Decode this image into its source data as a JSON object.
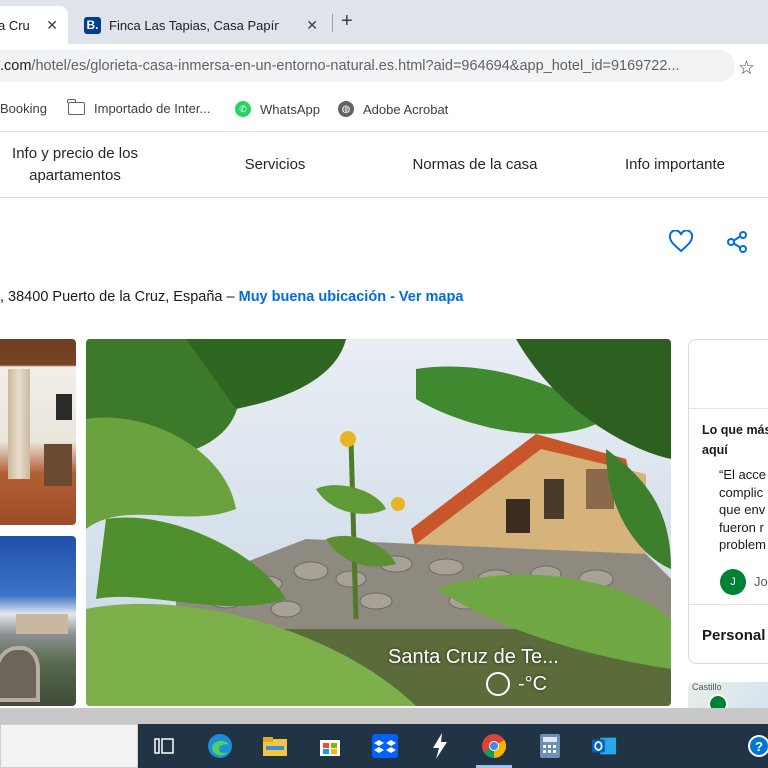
{
  "browser": {
    "tabs": [
      {
        "title": "a Cru",
        "close": "✕"
      },
      {
        "title": "Finca Las Tapias, Casa Papín ·",
        "close": "✕",
        "favicon": "B."
      }
    ],
    "new_tab": "+",
    "url_host": ".com",
    "url_path": "/hotel/es/glorieta-casa-inmersa-en-un-entorno-natural.es.html?aid=964694&app_hotel_id=9169722...",
    "star": "☆",
    "bookmarks": [
      "Booking",
      "Importado de Inter...",
      "WhatsApp",
      "Adobe Acrobat"
    ]
  },
  "page_nav": [
    "Info y precio de los apartamentos",
    "Servicios",
    "Normas de la casa",
    "Info importante"
  ],
  "address": {
    "text": ", 38400 Puerto de la Cruz, España –",
    "location_link": "Muy buena ubicación - Ver mapa"
  },
  "photo": {
    "caption": "Santa Cruz de Te...",
    "temperature": "-°C"
  },
  "review_card": {
    "heading_line1": "Lo que más",
    "heading_line2": "aquí",
    "quote_lines": [
      "“El acce",
      "complic",
      "que env",
      "fueron r",
      "problem"
    ],
    "avatar_initial": "J",
    "reviewer": "Jos",
    "personal": "Personal"
  },
  "map": {
    "label": "Castillo"
  },
  "colors": {
    "link": "#006ce4",
    "brand": "#003b95",
    "taskbar": "#203446"
  },
  "taskbar_icons": [
    "task-view-icon",
    "edge-icon",
    "file-explorer-icon",
    "store-icon",
    "dropbox-icon",
    "bolt-icon",
    "chrome-icon",
    "calculator-icon",
    "outlook-icon",
    "help-icon"
  ]
}
